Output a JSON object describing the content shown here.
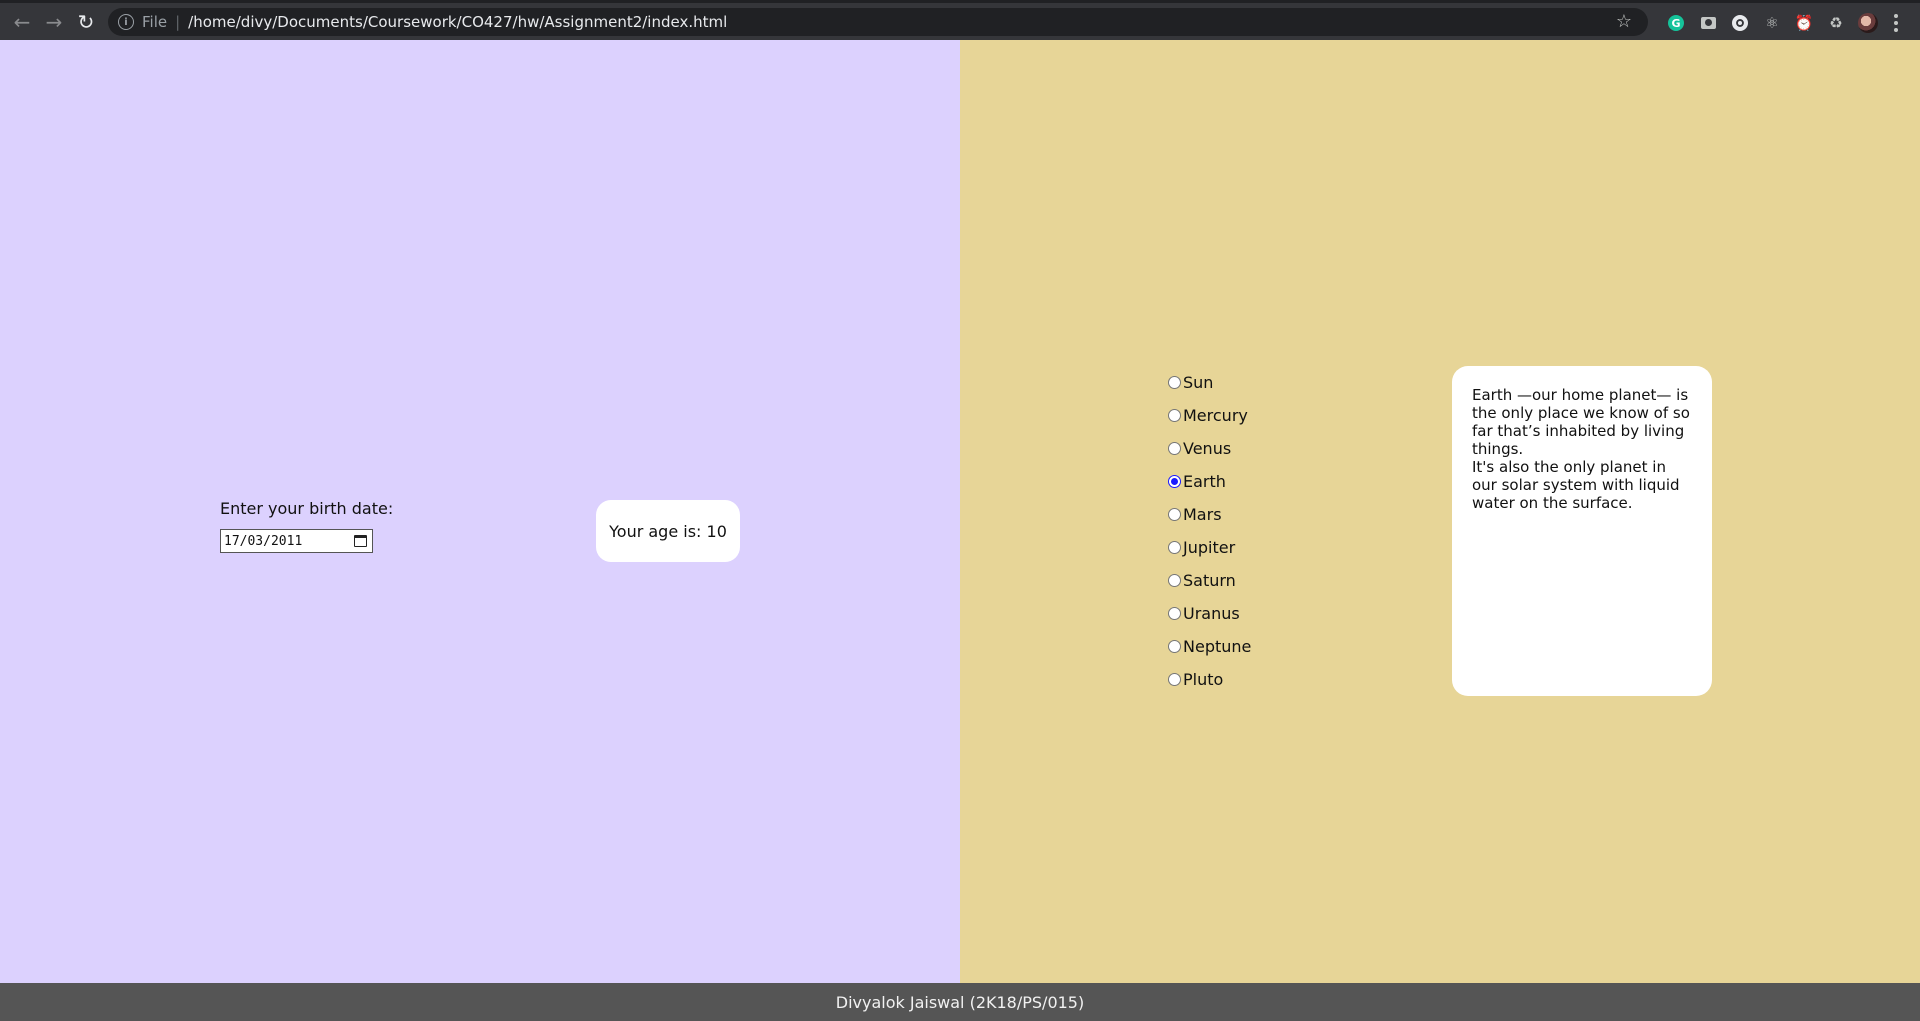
{
  "browser": {
    "url_scheme": "File",
    "url": "/home/divy/Documents/Coursework/CO427/hw/Assignment2/index.html",
    "nav": {
      "back_icon": "back-arrow-icon",
      "forward_icon": "forward-arrow-icon",
      "reload_icon": "reload-icon"
    },
    "extensions": [
      "grammarly-icon",
      "camera-icon",
      "circle-extension-icon",
      "react-devtools-icon",
      "alarm-icon",
      "puzzle-extensions-icon",
      "profile-avatar"
    ]
  },
  "age_section": {
    "label": "Enter your birth date:",
    "date_value": "17/03/2011",
    "age_text": "Your age is: 10"
  },
  "planets": {
    "options": [
      "Sun",
      "Mercury",
      "Venus",
      "Earth",
      "Mars",
      "Jupiter",
      "Saturn",
      "Uranus",
      "Neptune",
      "Pluto"
    ],
    "selected": "Earth",
    "description_line1": "Earth —our home planet— is the only place we know of so far that’s inhabited by living things.",
    "description_line2": "It's also the only planet in our solar system with liquid water on the surface."
  },
  "footer": {
    "text": "Divyalok Jaiswal (2K18/PS/015)"
  },
  "colors": {
    "left_bg": "#dcd1fe",
    "right_bg": "#e7d597",
    "footer_bg": "#555555",
    "radio_checked": "#1a1aff"
  }
}
